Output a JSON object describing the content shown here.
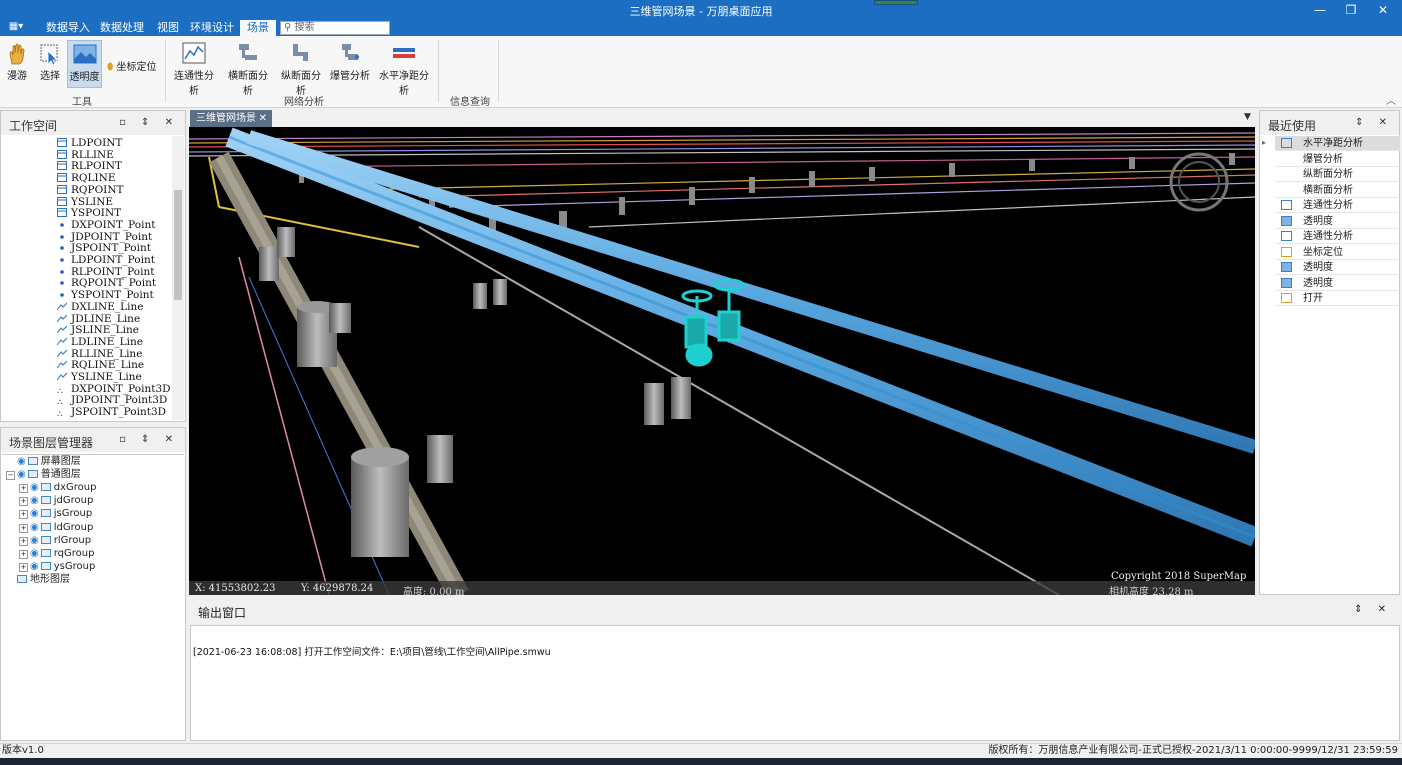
{
  "window": {
    "title": "三维管网场景 - 万朋桌面应用",
    "controls": [
      "—",
      "❐",
      "✕"
    ]
  },
  "ribbon": {
    "app_menu": "▦▾",
    "tabs": [
      "数据导入",
      "数据处理",
      "视图",
      "环境设计",
      "场景"
    ],
    "active_tab": "场景",
    "search_placeholder": "搜索",
    "groups": {
      "tools": {
        "label": "工具",
        "buttons": [
          "漫游",
          "选择",
          "透明度"
        ],
        "small_button": "坐标定位"
      },
      "network": {
        "label": "网络分析",
        "buttons": [
          "连通性分析",
          "横断面分析",
          "纵断面分析",
          "爆管分析",
          "水平净距分析"
        ]
      },
      "info": {
        "label": "信息查询"
      }
    }
  },
  "workspace": {
    "title": "工作空间",
    "items": [
      "LDPOINT",
      "RLLINE",
      "RLPOINT",
      "RQLINE",
      "RQPOINT",
      "YSLINE",
      "YSPOINT",
      "DXPOINT_Point",
      "JDPOINT_Point",
      "JSPOINT_Point",
      "LDPOINT_Point",
      "RLPOINT_Point",
      "RQPOINT_Point",
      "YSPOINT_Point",
      "DXLINE_Line",
      "JDLINE_Line",
      "JSLINE_Line",
      "LDLINE_Line",
      "RLLINE_Line",
      "RQLINE_Line",
      "YSLINE_Line",
      "DXPOINT_Point3D",
      "JDPOINT_Point3D",
      "JSPOINT_Point3D"
    ]
  },
  "layer_manager": {
    "title": "场景图层管理器",
    "items": [
      {
        "label": "屏幕图层",
        "level": 0
      },
      {
        "label": "普通图层",
        "level": 0
      },
      {
        "label": "dxGroup",
        "level": 1
      },
      {
        "label": "jdGroup",
        "level": 1
      },
      {
        "label": "jsGroup",
        "level": 1
      },
      {
        "label": "ldGroup",
        "level": 1
      },
      {
        "label": "rlGroup",
        "level": 1
      },
      {
        "label": "rqGroup",
        "level": 1
      },
      {
        "label": "ysGroup",
        "level": 1
      },
      {
        "label": "地形图层",
        "level": 0
      }
    ]
  },
  "scene": {
    "tab_label": "三维管网场景",
    "x_readout": "X: 41553802.23",
    "y_readout": "Y: 4629878.24",
    "height_readout": "高度: 0.00 m",
    "copyright": "Copyright 2018 SuperMap",
    "camera_height": "相机高度 23.28 m"
  },
  "output": {
    "title": "输出窗口",
    "log": "[2021-06-23 16:08:08] 打开工作空间文件：E:\\项目\\管线\\工作空间\\AllPipe.smwu"
  },
  "recent": {
    "title": "最近使用",
    "items": [
      {
        "label": "水平净距分析",
        "icon": "horizontal-distance-icon",
        "selected": true
      },
      {
        "label": "爆管分析",
        "icon": ""
      },
      {
        "label": "纵断面分析",
        "icon": ""
      },
      {
        "label": "横断面分析",
        "icon": ""
      },
      {
        "label": "连通性分析",
        "icon": "connectivity-icon"
      },
      {
        "label": "透明度",
        "icon": "transparency-icon"
      },
      {
        "label": "连通性分析",
        "icon": "connectivity-icon"
      },
      {
        "label": "坐标定位",
        "icon": "locate-icon"
      },
      {
        "label": "透明度",
        "icon": "transparency-icon"
      },
      {
        "label": "透明度",
        "icon": "transparency-icon"
      },
      {
        "label": "打开",
        "icon": "open-folder-icon"
      }
    ]
  },
  "status": {
    "version": "版本v1.0",
    "copyright": "版权所有：万朋信息产业有限公司-正式已授权-2021/3/11 0:00:00-9999/12/31 23:59:59"
  },
  "colors": {
    "accent": "#1b6ec2",
    "pipe_main": "#5aa8e0",
    "valve": "#1fd0d0"
  }
}
